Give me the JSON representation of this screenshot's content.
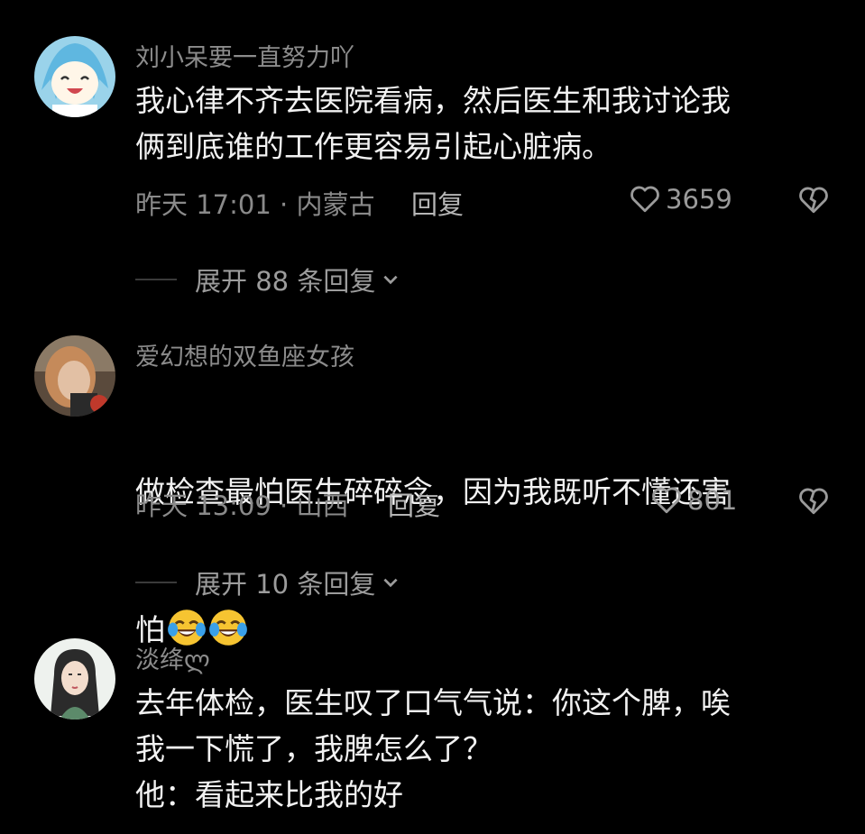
{
  "comments": [
    {
      "username": "刘小呆要一直努力吖",
      "text": "我心律不齐去医院看病，然后医生和我讨论我\n俩到底谁的工作更容易引起心脏病。",
      "time": "昨天 17:01 · 内蒙古",
      "reply_label": "回复",
      "likes": "3659",
      "expand_label": "展开 88 条回复"
    },
    {
      "username": "爱幻想的双鱼座女孩",
      "text_line1": "做检查最怕医生碎碎念，因为我既听不懂还害",
      "text_line2": "怕",
      "emoji": [
        "crying-laughing-emoji",
        "crying-laughing-emoji"
      ],
      "time": "昨天 13:09 · 山西",
      "reply_label": "回复",
      "likes": "801",
      "expand_label": "展开 10 条回复"
    },
    {
      "username": "淡绛ლ",
      "text": "去年体检，医生叹了口气气说：你这个脾，唉\n我一下慌了，我脾怎么了？\n他：看起来比我的好"
    }
  ],
  "icons": {
    "like": "heart-outline-icon",
    "dislike": "broken-heart-icon",
    "expand": "chevron-down-icon"
  }
}
